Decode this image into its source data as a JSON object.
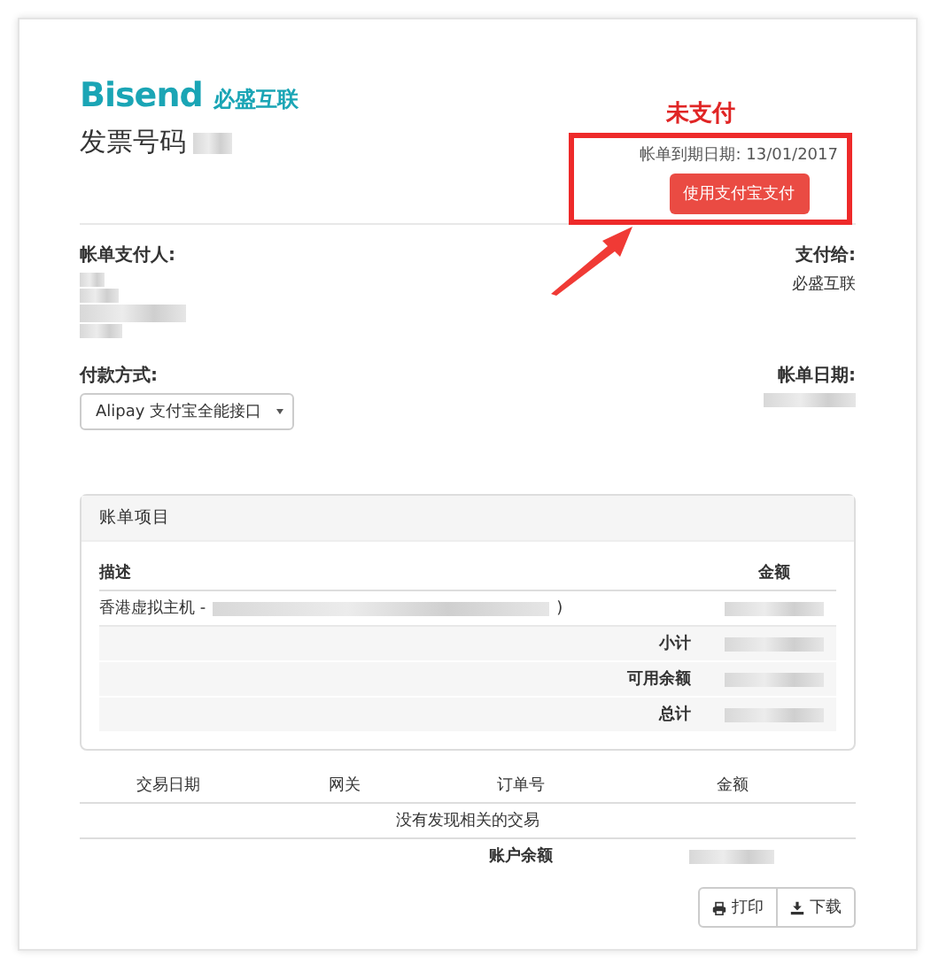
{
  "logo": {
    "wordmark": "Bisend",
    "name": "必盛互联"
  },
  "invoice": {
    "title": "发票号码"
  },
  "annotation": {
    "label": "未支付"
  },
  "due": {
    "label": "帐单到期日期: 13/01/2017",
    "pay_button": "使用支付宝支付"
  },
  "payer": {
    "label": "帐单支付人:"
  },
  "payee": {
    "label": "支付给:",
    "value": "必盛互联"
  },
  "payment": {
    "label": "付款方式:",
    "value": "Alipay 支付宝全能接口"
  },
  "bill_date": {
    "label": "帐单日期:"
  },
  "items": {
    "title": "账单项目",
    "columns": [
      "描述",
      "金额"
    ],
    "rows": [
      {
        "description": "香港虚拟主机 -",
        "suffix": ")"
      }
    ],
    "totals": [
      "小计",
      "可用余额",
      "总计"
    ]
  },
  "transactions": {
    "columns": [
      "交易日期",
      "网关",
      "订单号",
      "金额"
    ],
    "empty": "没有发现相关的交易",
    "balance_label": "账户余额"
  },
  "buttons": [
    {
      "kind": "print",
      "label": "打印"
    },
    {
      "kind": "download",
      "label": "下载"
    }
  ]
}
